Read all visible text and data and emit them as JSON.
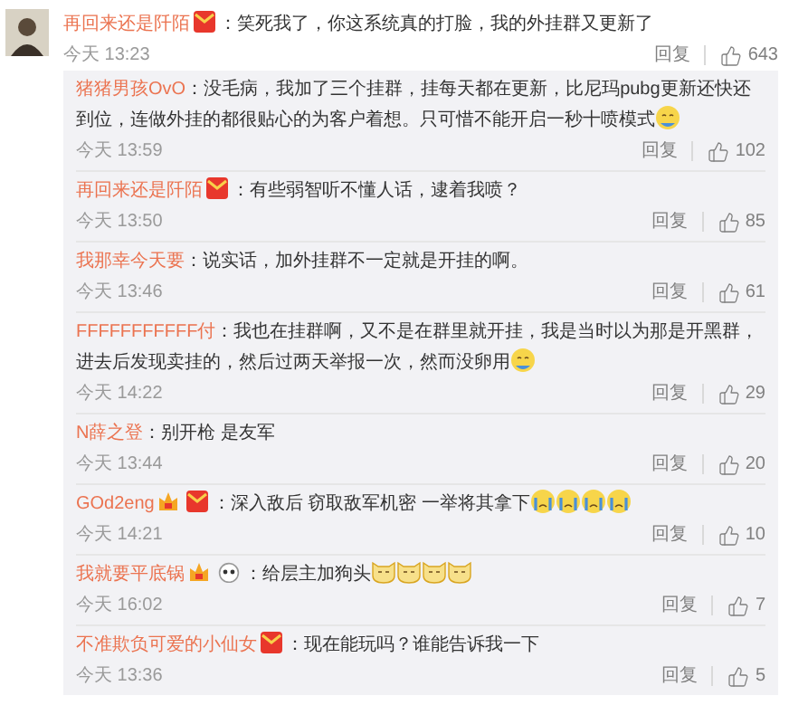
{
  "comment": {
    "user": "再回来还是阡陌",
    "badges": [
      {
        "kind": "envelope"
      }
    ],
    "text": "：笑死我了，你这系统真的打脸，我的外挂群又更新了",
    "time": "今天 13:23",
    "reply": "回复",
    "likes": "643"
  },
  "replies": [
    {
      "user": "猪猪男孩OvO",
      "text": "：没毛病，我加了三个挂群，挂每天都在更新，比尼玛pubg更新还快还到位，连做外挂的都很贴心的为客户着想。只可惜不能开启一秒十喷模式",
      "emojis": [
        {
          "kind": "smile"
        }
      ],
      "time": "今天 13:59",
      "reply": "回复",
      "likes": "102"
    },
    {
      "user": "再回来还是阡陌",
      "badges": [
        {
          "kind": "envelope"
        }
      ],
      "text": "：有些弱智听不懂人话，逮着我喷？",
      "time": "今天 13:50",
      "reply": "回复",
      "likes": "85"
    },
    {
      "user": "我那幸今天要",
      "text": "：说实话，加外挂群不一定就是开挂的啊。",
      "time": "今天 13:46",
      "reply": "回复",
      "likes": "61"
    },
    {
      "user": "FFFFFFFFFFF付",
      "text": "：我也在挂群啊，又不是在群里就开挂，我是当时以为那是开黑群，进去后发现卖挂的，然后过两天举报一次，然而没卵用",
      "emojis": [
        {
          "kind": "smile"
        }
      ],
      "time": "今天 14:22",
      "reply": "回复",
      "likes": "29"
    },
    {
      "user": "N薛之登",
      "text": "：别开枪 是友军",
      "time": "今天 13:44",
      "reply": "回复",
      "likes": "20"
    },
    {
      "user": "GOd2eng",
      "badges": [
        {
          "kind": "crown"
        },
        {
          "kind": "envelope"
        }
      ],
      "text": "：深入敌后 窃取敌军机密 一举将其拿下",
      "emojis": [
        {
          "kind": "cry"
        },
        {
          "kind": "cry"
        },
        {
          "kind": "cry"
        },
        {
          "kind": "cry"
        }
      ],
      "time": "今天 14:21",
      "reply": "回复",
      "likes": "10"
    },
    {
      "user": "我就要平底锅",
      "badges": [
        {
          "kind": "crown"
        },
        {
          "kind": "panda"
        }
      ],
      "text": "：给层主加狗头",
      "emojis": [
        {
          "kind": "doge"
        },
        {
          "kind": "doge"
        },
        {
          "kind": "doge"
        },
        {
          "kind": "doge"
        }
      ],
      "time": "今天 16:02",
      "reply": "回复",
      "likes": "7"
    },
    {
      "user": "不准欺负可爱的小仙女",
      "badges": [
        {
          "kind": "envelope"
        }
      ],
      "text": "：现在能玩吗？谁能告诉我一下",
      "time": "今天 13:36",
      "reply": "回复",
      "likes": "5"
    }
  ]
}
